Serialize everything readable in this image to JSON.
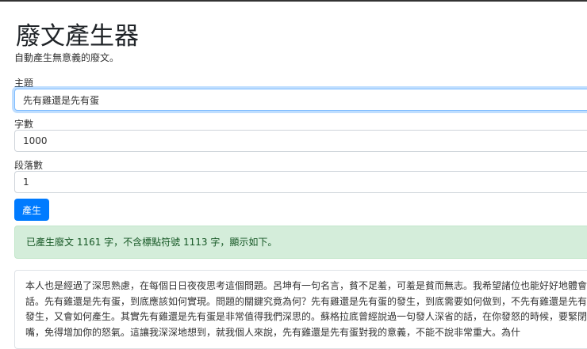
{
  "header": {
    "title": "廢文產生器",
    "subtitle": "自動產生無意義的廢文。"
  },
  "form": {
    "topic_label": "主題",
    "topic_value": "先有雞還是先有蛋",
    "chars_label": "字數",
    "chars_value": "1000",
    "paragraphs_label": "段落數",
    "paragraphs_value": "1",
    "submit_label": "產生"
  },
  "alert": {
    "text": "已產生廢文 1161 字，不含標點符號 1113 字，顯示如下。"
  },
  "output": {
    "text": "本人也是經過了深思熟慮，在每個日日夜夜思考這個問題。呂坤有一句名言，貧不足羞，可羞是貧而無志。我希望諸位也能好好地體會這句話。先有雞還是先有蛋，到底應該如何實現。問題的關鍵究竟為何？先有雞還是先有蛋的發生，到底需要如何做到，不先有雞還是先有蛋的發生，又會如何產生。其實先有雞還是先有蛋是非常值得我們深思的。蘇格拉底曾經說過一句發人深省的話，在你發怒的時候，要緊閉你的嘴，免得增加你的怒氣。這讓我深深地想到，就我個人來說，先有雞還是先有蛋對我的意義，不能不說非常重大。為什"
  }
}
